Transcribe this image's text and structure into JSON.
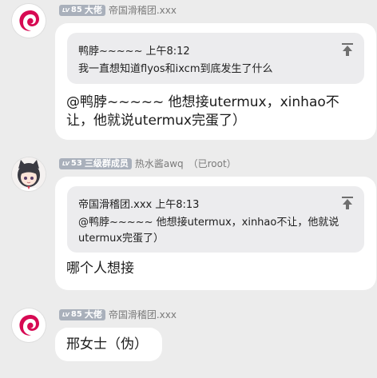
{
  "messages": [
    {
      "avatar_icon": "debian-swirl-icon",
      "level": "85",
      "level_prefix": "LV",
      "group_title": "大佬",
      "sender": "帝国滑稽团.xxx",
      "extra": "",
      "quote": {
        "author": "鸭脖~~~~~",
        "time": "上午8:12",
        "text": "我一直想知道flyos和ixcm到底发生了什么"
      },
      "text": "@鸭脖~~~~~ 他想接utermux，xinhao不让，他就说utermux完蛋了）"
    },
    {
      "avatar_icon": "anime-cat-girl-avatar",
      "level": "53",
      "level_prefix": "LV",
      "group_title": "三级群成员",
      "sender": "热水酱awq",
      "extra": "（已root）",
      "quote": {
        "author": "帝国滑稽团.xxx",
        "time": "上午8:13",
        "text": "@鸭脖~~~~~ 他想接utermux，xinhao不让，他就说utermux完蛋了）"
      },
      "text": "哪个人想接"
    },
    {
      "avatar_icon": "debian-swirl-icon",
      "level": "85",
      "level_prefix": "LV",
      "group_title": "大佬",
      "sender": "帝国滑稽团.xxx",
      "extra": "",
      "text": "邢女士（伪）"
    }
  ],
  "colors": {
    "background": "#ececec",
    "bubble": "#ffffff",
    "quote_bg": "#ececee",
    "badge": "#a9b0bb",
    "debian_red": "#d70a53"
  }
}
